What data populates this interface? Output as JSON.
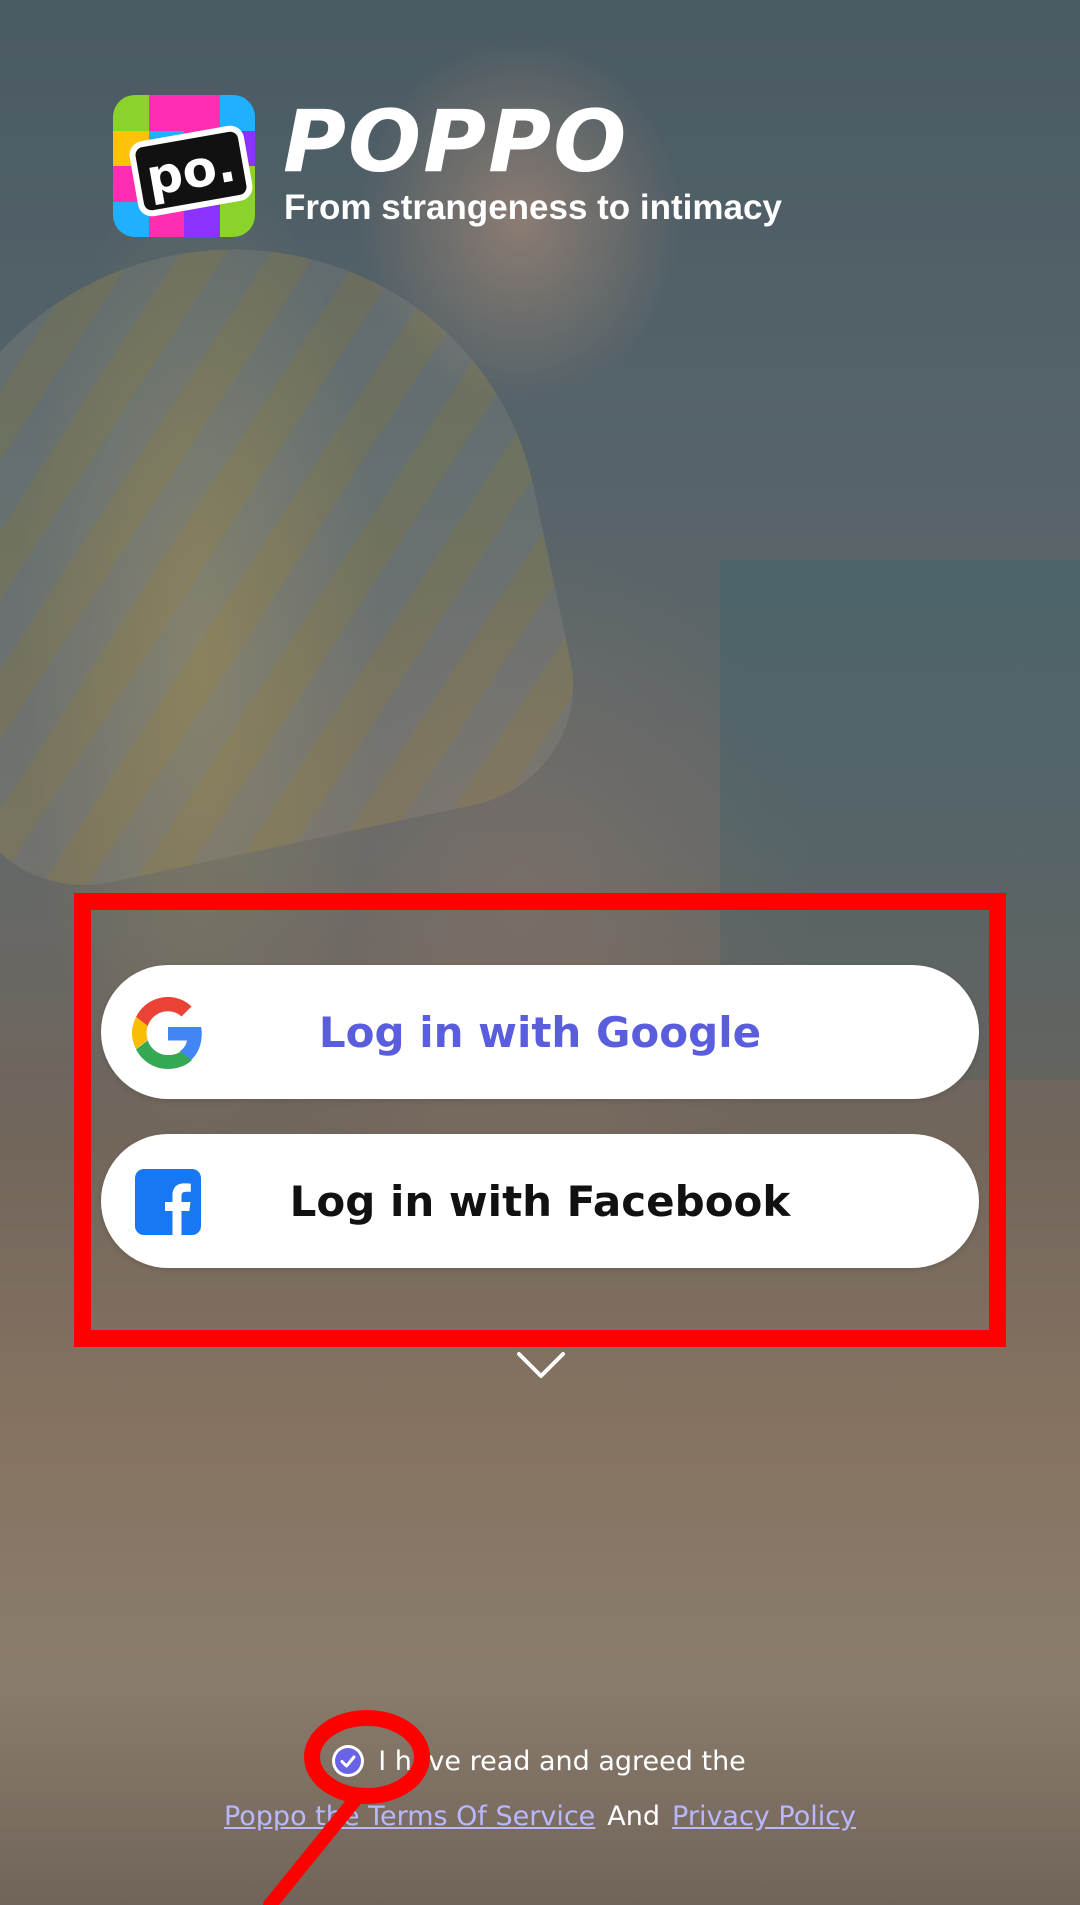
{
  "app": {
    "brand_name": "POPPO",
    "logo_mark": "po.",
    "tagline": "From strangeness to intimacy"
  },
  "login": {
    "google_label": "Log in with Google",
    "facebook_label": "Log in with Facebook",
    "google_icon": "google-icon",
    "facebook_icon": "facebook-icon"
  },
  "agreement": {
    "checked": true,
    "statement": "I have read and agreed the",
    "terms_link": "Poppo the Terms Of Service",
    "conjunction": "And",
    "privacy_link": "Privacy Policy"
  },
  "colors": {
    "google_text": "#5a5ddc",
    "link": "#b9b8ff",
    "highlight": "#ff0000",
    "check": "#6a63e8"
  }
}
